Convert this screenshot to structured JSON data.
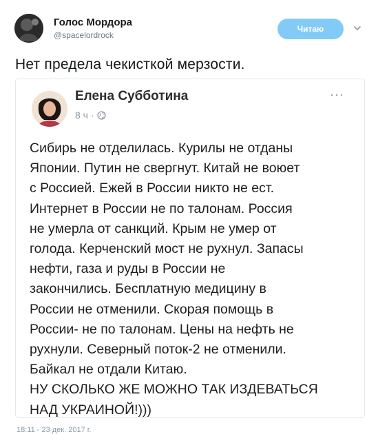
{
  "tweet": {
    "author": {
      "display_name": "Голос Мордора",
      "handle": "@spacelordrock",
      "avatar_icon": "user-avatar-icon"
    },
    "follow_button_label": "Читаю",
    "menu_icon": "chevron-down-icon",
    "text": "Нет предела чекисткой мерзости.",
    "timestamp": "18:11 - 23 дек. 2017 г.",
    "accent_color": "#1da1f2"
  },
  "embedded_post": {
    "author_name": "Елена Субботина",
    "time": "8 ч",
    "separator": "·",
    "privacy_icon": "globe-icon",
    "more_label": "···",
    "lines": [
      "Сибирь не отделилась. Курилы не отданы",
      "Японии. Путин не свергнут. Китай не воюет",
      "с Россией. Ежей в России никто не ест.",
      "Интернет в России не по талонам. Россия",
      "не умерла от санкций. Крым не умер от",
      "голода. Керченский мост не рухнул. Запасы",
      "нефти, газа и руды в России не",
      "закончились. Бесплатную медицину в",
      "России не отменили. Скорая помощь в",
      "России- не по талонам. Цены на нефть не",
      "рухнули. Северный поток-2 не отменили.",
      "Байкал не отдали Китаю.",
      "НУ СКОЛЬКО ЖЕ МОЖНО ТАК ИЗДЕВАТЬСЯ",
      "НАД УКРАИНОЙ!)))"
    ]
  }
}
